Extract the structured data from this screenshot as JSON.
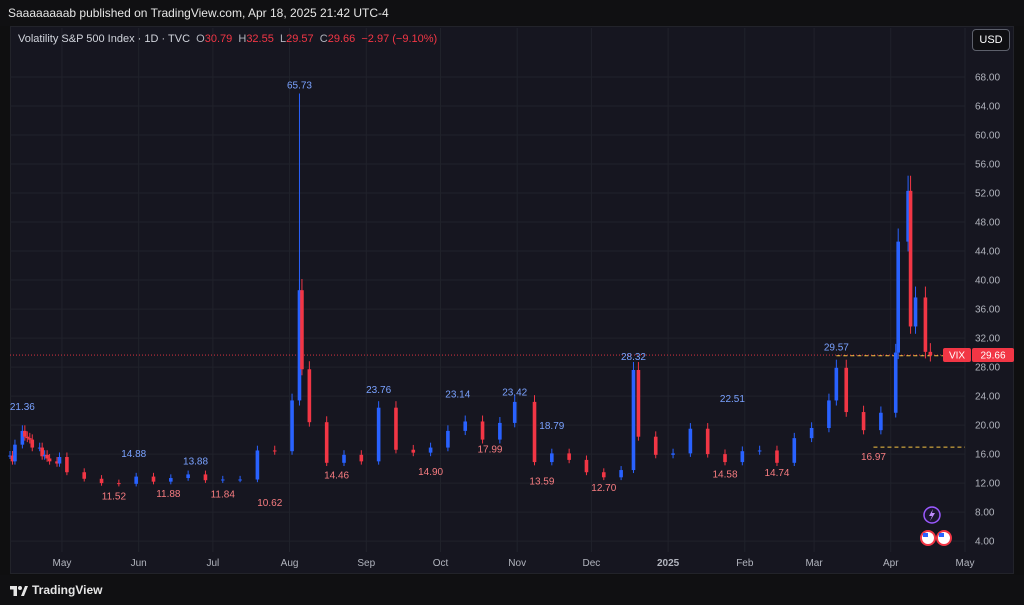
{
  "header": {
    "published": "Saaaaaaaab published on TradingView.com, Apr 18, 2025 21:42 UTC-4"
  },
  "legend": {
    "title": "Volatility S&P 500 Index · 1D · TVC",
    "o_label": "O",
    "o_value": "30.79",
    "h_label": "H",
    "h_value": "32.55",
    "l_label": "L",
    "l_value": "29.57",
    "c_label": "C",
    "c_value": "29.66",
    "change": "−2.97 (−9.10%)"
  },
  "currency_button": "USD",
  "price_tag": {
    "symbol": "VIX",
    "value": "29.66"
  },
  "footer": {
    "brand": "TradingView"
  },
  "colors": {
    "up": "#2962ff",
    "down": "#f23645",
    "background": "#161620",
    "level": "#f5c242"
  },
  "chart_data": {
    "type": "candlestick",
    "title": "Volatility S&P 500 Index · 1D · TVC",
    "xlabel": "",
    "ylabel": "",
    "ylim": [
      2.5,
      72
    ],
    "y_ticks": [
      "4.00",
      "8.00",
      "12.00",
      "16.00",
      "20.00",
      "24.00",
      "28.00",
      "32.00",
      "36.00",
      "40.00",
      "44.00",
      "48.00",
      "52.00",
      "56.00",
      "60.00",
      "64.00",
      "68.00"
    ],
    "x_ticks": [
      {
        "label": "May",
        "date": "2024-05-01"
      },
      {
        "label": "Jun",
        "date": "2024-06-01"
      },
      {
        "label": "Jul",
        "date": "2024-07-01"
      },
      {
        "label": "Aug",
        "date": "2024-08-01"
      },
      {
        "label": "Sep",
        "date": "2024-09-01"
      },
      {
        "label": "Oct",
        "date": "2024-10-01"
      },
      {
        "label": "Nov",
        "date": "2024-11-01"
      },
      {
        "label": "Dec",
        "date": "2024-12-01"
      },
      {
        "label": "2025",
        "date": "2025-01-01"
      },
      {
        "label": "Feb",
        "date": "2025-02-01"
      },
      {
        "label": "Mar",
        "date": "2025-03-01"
      },
      {
        "label": "Apr",
        "date": "2025-04-01"
      },
      {
        "label": "May",
        "date": "2025-05-01"
      }
    ],
    "x_range": [
      "2024-04-10",
      "2025-05-01"
    ],
    "price_line": 29.66,
    "levels": [
      29.57,
      16.97
    ],
    "annotations": [
      {
        "text": "21.36",
        "date": "2024-04-15",
        "value": 21.36,
        "kind": "high"
      },
      {
        "text": "14.88",
        "date": "2024-05-30",
        "value": 14.88,
        "kind": "high"
      },
      {
        "text": "11.52",
        "date": "2024-05-22",
        "value": 11.52,
        "kind": "low"
      },
      {
        "text": "11.88",
        "date": "2024-06-13",
        "value": 11.88,
        "kind": "low"
      },
      {
        "text": "13.88",
        "date": "2024-06-24",
        "value": 13.88,
        "kind": "high"
      },
      {
        "text": "11.84",
        "date": "2024-07-05",
        "value": 11.84,
        "kind": "low"
      },
      {
        "text": "10.62",
        "date": "2024-07-24",
        "value": 10.62,
        "kind": "low"
      },
      {
        "text": "65.73",
        "date": "2024-08-05",
        "value": 65.73,
        "kind": "high"
      },
      {
        "text": "14.46",
        "date": "2024-08-20",
        "value": 14.46,
        "kind": "low"
      },
      {
        "text": "23.76",
        "date": "2024-09-06",
        "value": 23.76,
        "kind": "high"
      },
      {
        "text": "14.90",
        "date": "2024-09-27",
        "value": 14.9,
        "kind": "low"
      },
      {
        "text": "23.14",
        "date": "2024-10-08",
        "value": 23.14,
        "kind": "high"
      },
      {
        "text": "17.99",
        "date": "2024-10-21",
        "value": 17.99,
        "kind": "low"
      },
      {
        "text": "23.42",
        "date": "2024-10-31",
        "value": 23.42,
        "kind": "high"
      },
      {
        "text": "18.79",
        "date": "2024-11-15",
        "value": 18.79,
        "kind": "high"
      },
      {
        "text": "13.59",
        "date": "2024-11-11",
        "value": 13.59,
        "kind": "low"
      },
      {
        "text": "12.70",
        "date": "2024-12-06",
        "value": 12.7,
        "kind": "low"
      },
      {
        "text": "28.32",
        "date": "2024-12-18",
        "value": 28.32,
        "kind": "high"
      },
      {
        "text": "22.51",
        "date": "2025-01-27",
        "value": 22.51,
        "kind": "high"
      },
      {
        "text": "14.58",
        "date": "2025-01-24",
        "value": 14.58,
        "kind": "low"
      },
      {
        "text": "14.74",
        "date": "2025-02-14",
        "value": 14.74,
        "kind": "low"
      },
      {
        "text": "29.57",
        "date": "2025-03-10",
        "value": 29.57,
        "kind": "high"
      },
      {
        "text": "16.97",
        "date": "2025-03-25",
        "value": 16.97,
        "kind": "low"
      }
    ],
    "series": [
      {
        "date": "2024-04-10",
        "close": 15.8
      },
      {
        "date": "2024-04-11",
        "close": 15.0
      },
      {
        "date": "2024-04-12",
        "close": 17.3
      },
      {
        "date": "2024-04-15",
        "close": 19.2
      },
      {
        "date": "2024-04-16",
        "close": 18.4
      },
      {
        "date": "2024-04-17",
        "close": 18.2
      },
      {
        "date": "2024-04-18",
        "close": 18.0
      },
      {
        "date": "2024-04-19",
        "close": 16.9
      },
      {
        "date": "2024-04-22",
        "close": 16.9
      },
      {
        "date": "2024-04-23",
        "close": 15.7
      },
      {
        "date": "2024-04-24",
        "close": 15.9
      },
      {
        "date": "2024-04-25",
        "close": 15.4
      },
      {
        "date": "2024-04-26",
        "close": 15.0
      },
      {
        "date": "2024-04-29",
        "close": 14.7
      },
      {
        "date": "2024-04-30",
        "close": 15.6
      },
      {
        "date": "2024-05-03",
        "close": 13.5
      },
      {
        "date": "2024-05-10",
        "close": 12.6
      },
      {
        "date": "2024-05-17",
        "close": 12.0
      },
      {
        "date": "2024-05-24",
        "close": 11.9
      },
      {
        "date": "2024-05-31",
        "close": 12.9
      },
      {
        "date": "2024-06-07",
        "close": 12.2
      },
      {
        "date": "2024-06-14",
        "close": 12.7
      },
      {
        "date": "2024-06-21",
        "close": 13.2
      },
      {
        "date": "2024-06-28",
        "close": 12.4
      },
      {
        "date": "2024-07-05",
        "close": 12.5
      },
      {
        "date": "2024-07-12",
        "close": 12.5
      },
      {
        "date": "2024-07-19",
        "close": 16.5
      },
      {
        "date": "2024-07-26",
        "close": 16.4
      },
      {
        "date": "2024-08-02",
        "close": 23.4
      },
      {
        "date": "2024-08-05",
        "close": 38.6
      },
      {
        "date": "2024-08-06",
        "close": 27.7
      },
      {
        "date": "2024-08-09",
        "close": 20.4
      },
      {
        "date": "2024-08-16",
        "close": 14.8
      },
      {
        "date": "2024-08-23",
        "close": 15.9
      },
      {
        "date": "2024-08-30",
        "close": 15.0
      },
      {
        "date": "2024-09-06",
        "close": 22.4
      },
      {
        "date": "2024-09-13",
        "close": 16.6
      },
      {
        "date": "2024-09-20",
        "close": 16.2
      },
      {
        "date": "2024-09-27",
        "close": 16.9
      },
      {
        "date": "2024-10-04",
        "close": 19.2
      },
      {
        "date": "2024-10-11",
        "close": 20.5
      },
      {
        "date": "2024-10-18",
        "close": 18.0
      },
      {
        "date": "2024-10-25",
        "close": 20.3
      },
      {
        "date": "2024-10-31",
        "close": 23.2
      },
      {
        "date": "2024-11-08",
        "close": 14.9
      },
      {
        "date": "2024-11-15",
        "close": 16.1
      },
      {
        "date": "2024-11-22",
        "close": 15.2
      },
      {
        "date": "2024-11-29",
        "close": 13.5
      },
      {
        "date": "2024-12-06",
        "close": 12.8
      },
      {
        "date": "2024-12-13",
        "close": 13.8
      },
      {
        "date": "2024-12-18",
        "close": 27.6
      },
      {
        "date": "2024-12-20",
        "close": 18.4
      },
      {
        "date": "2024-12-27",
        "close": 15.9
      },
      {
        "date": "2025-01-03",
        "close": 16.1
      },
      {
        "date": "2025-01-10",
        "close": 19.5
      },
      {
        "date": "2025-01-17",
        "close": 16.0
      },
      {
        "date": "2025-01-24",
        "close": 14.9
      },
      {
        "date": "2025-01-31",
        "close": 16.4
      },
      {
        "date": "2025-02-07",
        "close": 16.5
      },
      {
        "date": "2025-02-14",
        "close": 14.8
      },
      {
        "date": "2025-02-21",
        "close": 18.2
      },
      {
        "date": "2025-02-28",
        "close": 19.6
      },
      {
        "date": "2025-03-07",
        "close": 23.4
      },
      {
        "date": "2025-03-10",
        "close": 27.9
      },
      {
        "date": "2025-03-14",
        "close": 21.8
      },
      {
        "date": "2025-03-21",
        "close": 19.3
      },
      {
        "date": "2025-03-28",
        "close": 21.7
      },
      {
        "date": "2025-04-03",
        "close": 30.0
      },
      {
        "date": "2025-04-04",
        "close": 45.3
      },
      {
        "date": "2025-04-08",
        "close": 52.3
      },
      {
        "date": "2025-04-09",
        "close": 33.6
      },
      {
        "date": "2025-04-11",
        "close": 37.6
      },
      {
        "date": "2025-04-15",
        "close": 30.1
      },
      {
        "date": "2025-04-17",
        "close": 29.66
      }
    ]
  }
}
